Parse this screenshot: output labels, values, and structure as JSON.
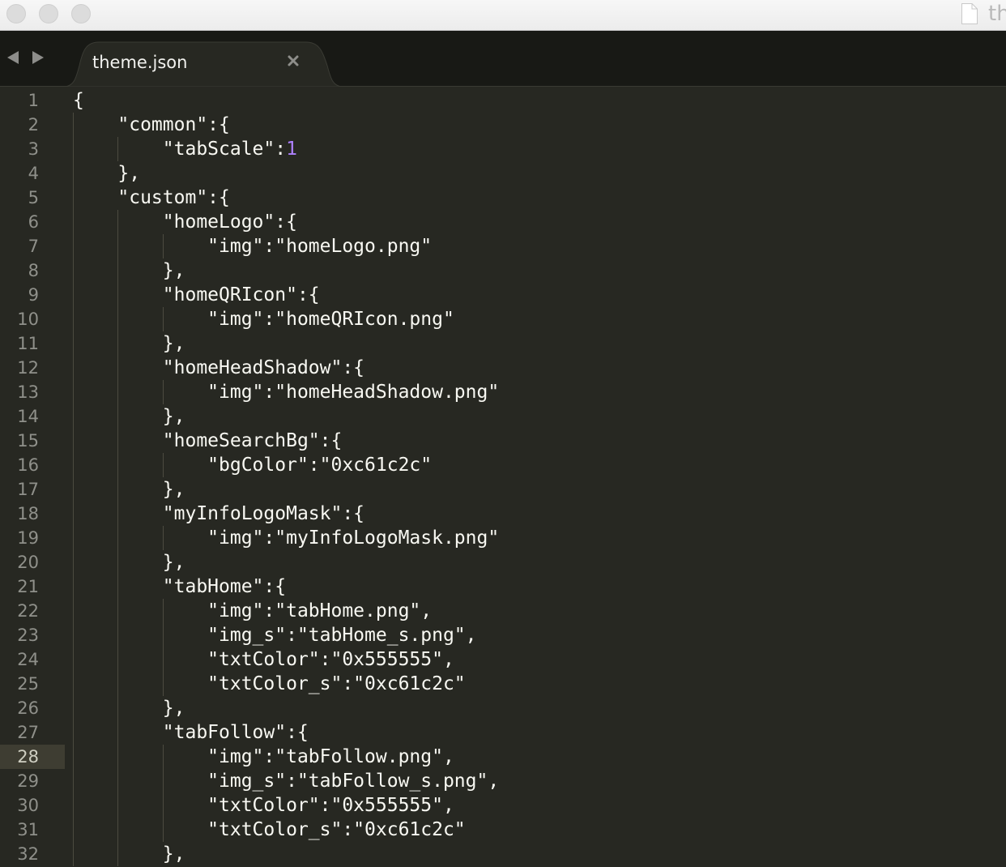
{
  "window": {
    "title": "th",
    "file_icon": "document-icon"
  },
  "tab_bar": {
    "tab_label": "theme.json",
    "close_icon": "close-icon",
    "back_icon": "arrow-left-icon",
    "forward_icon": "arrow-right-icon"
  },
  "editor": {
    "active_line": 28,
    "lines": [
      {
        "no": "1",
        "text": "{"
      },
      {
        "no": "2",
        "text": "    \"common\":{"
      },
      {
        "no": "3",
        "text": "        \"tabScale\":",
        "num": "1"
      },
      {
        "no": "4",
        "text": "    },"
      },
      {
        "no": "5",
        "text": "    \"custom\":{"
      },
      {
        "no": "6",
        "text": "        \"homeLogo\":{"
      },
      {
        "no": "7",
        "text": "            \"img\":\"homeLogo.png\""
      },
      {
        "no": "8",
        "text": "        },"
      },
      {
        "no": "9",
        "text": "        \"homeQRIcon\":{"
      },
      {
        "no": "10",
        "text": "            \"img\":\"homeQRIcon.png\""
      },
      {
        "no": "11",
        "text": "        },"
      },
      {
        "no": "12",
        "text": "        \"homeHeadShadow\":{"
      },
      {
        "no": "13",
        "text": "            \"img\":\"homeHeadShadow.png\""
      },
      {
        "no": "14",
        "text": "        },"
      },
      {
        "no": "15",
        "text": "        \"homeSearchBg\":{"
      },
      {
        "no": "16",
        "text": "            \"bgColor\":\"0xc61c2c\""
      },
      {
        "no": "17",
        "text": "        },"
      },
      {
        "no": "18",
        "text": "        \"myInfoLogoMask\":{"
      },
      {
        "no": "19",
        "text": "            \"img\":\"myInfoLogoMask.png\""
      },
      {
        "no": "20",
        "text": "        },"
      },
      {
        "no": "21",
        "text": "        \"tabHome\":{"
      },
      {
        "no": "22",
        "text": "            \"img\":\"tabHome.png\","
      },
      {
        "no": "23",
        "text": "            \"img_s\":\"tabHome_s.png\","
      },
      {
        "no": "24",
        "text": "            \"txtColor\":\"0x555555\","
      },
      {
        "no": "25",
        "text": "            \"txtColor_s\":\"0xc61c2c\""
      },
      {
        "no": "26",
        "text": "        },"
      },
      {
        "no": "27",
        "text": "        \"tabFollow\":{"
      },
      {
        "no": "28",
        "text": "            \"img\":\"tabFollow.png\","
      },
      {
        "no": "29",
        "text": "            \"img_s\":\"tabFollow_s.png\","
      },
      {
        "no": "30",
        "text": "            \"txtColor\":\"0x555555\","
      },
      {
        "no": "31",
        "text": "            \"txtColor_s\":\"0xc61c2c\""
      },
      {
        "no": "32",
        "text": "        },"
      }
    ]
  },
  "colors": {
    "background": "#272822",
    "text": "#f8f8f2",
    "number": "#ae81ff",
    "gutter_text": "#8f908a",
    "tab_bar": "#181915"
  }
}
